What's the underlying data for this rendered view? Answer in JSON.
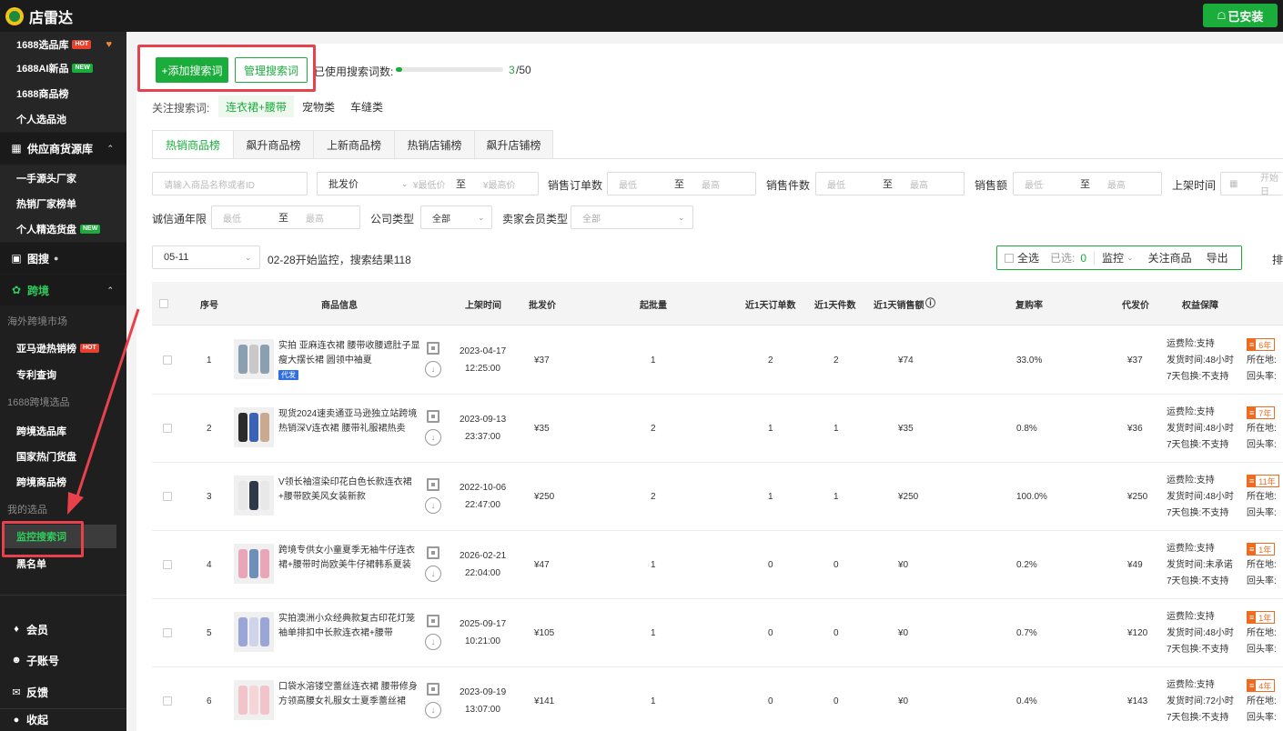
{
  "app": {
    "name": "店雷达",
    "installed_label": "已安装",
    "installed_icon": "home-icon"
  },
  "sidebar": {
    "items_top": [
      {
        "label": "1688选品库",
        "tag": "HOT"
      },
      {
        "label": "1688AI新品",
        "tag": "NEW"
      },
      {
        "label": "1688商品榜",
        "tag": ""
      },
      {
        "label": "个人选品池",
        "tag": ""
      }
    ],
    "group_supply": "供应商货源库",
    "supply_items": [
      {
        "label": "一手源头厂家",
        "tag": ""
      },
      {
        "label": "热销厂家榜单",
        "tag": ""
      },
      {
        "label": "个人精选货盘",
        "tag": "NEW"
      }
    ],
    "image_search": "图搜",
    "group_cross": "跨境",
    "cap_overseas": "海外跨境市场",
    "overseas_items": [
      {
        "label": "亚马逊热销榜",
        "tag": "HOT"
      },
      {
        "label": "专利查询",
        "tag": ""
      }
    ],
    "cap_1688": "1688跨境选品",
    "cross_items": [
      {
        "label": "跨境选品库"
      },
      {
        "label": "国家热门货盘"
      },
      {
        "label": "跨境商品榜"
      }
    ],
    "cap_mine": "我的选品",
    "selected": "监控搜索词",
    "blacklist": "黑名单",
    "bottom": [
      {
        "label": "会员",
        "icon": "diamond-icon"
      },
      {
        "label": "子账号",
        "icon": "users-icon"
      },
      {
        "label": "反馈",
        "icon": "chat-icon"
      },
      {
        "label": "收起",
        "icon": "collapse-icon"
      }
    ]
  },
  "toolbar": {
    "add_label": "+添加搜索词",
    "manage_label": "管理搜索词",
    "usage_label": "已使用搜索词数:",
    "usage_count": "3",
    "usage_total": "/50",
    "usage_fraction": 0.06
  },
  "keywords": {
    "label": "关注搜索词:",
    "items": [
      "连衣裙+腰带",
      "宠物类",
      "车缝类"
    ],
    "active": 0
  },
  "tabs": [
    "热销商品榜",
    "飙升商品榜",
    "上新商品榜",
    "热销店铺榜",
    "飙升店铺榜"
  ],
  "filters": {
    "search_placeholder": "请输入商品名称或者ID",
    "price_select": "批发价",
    "min_price": "¥最低价",
    "to": "至",
    "max_price": "¥最高价",
    "orders_label": "销售订单数",
    "low": "最低",
    "high": "最高",
    "pieces_label": "销售件数",
    "amount_label": "销售额",
    "listed_label": "上架时间",
    "start_date": "开始日",
    "years_label": "诚信通年限",
    "company_label": "公司类型",
    "company_value": "全部",
    "member_label": "卖家会员类型",
    "member_value": "全部"
  },
  "monitor": {
    "date": "05-11",
    "info": "02-28开始监控，搜索结果118",
    "select_all": "全选",
    "selected_label": "已选:",
    "selected_count": "0",
    "monitor_label": "监控",
    "follow_label": "关注商品",
    "export_label": "导出",
    "sort_label": "排"
  },
  "table": {
    "headers": {
      "seq": "序号",
      "info": "商品信息",
      "listed": "上架时间",
      "price": "批发价",
      "moq": "起批量",
      "orders": "近1天订单数",
      "pieces": "近1天件数",
      "sales": "近1天销售额",
      "repurchase": "复购率",
      "dropship": "代发价",
      "rights": "权益保障"
    },
    "rows": [
      {
        "seq": "1",
        "name": "实拍 亚麻连衣裙 腰带收腰遮肚子显瘦大摆长裙 圆领中袖夏",
        "daifa": "代发",
        "date": "2023-04-17",
        "time": "12:25:00",
        "price": "¥37",
        "moq": "1",
        "orders": "2",
        "pieces": "2",
        "sales": "¥74",
        "rep": "33.0%",
        "drop": "¥37",
        "freight": "运费险:支持",
        "ship": "发货时间:48小时",
        "ret": "7天包换:不支持",
        "years": "6年",
        "loc": "所在地:",
        "back": "回头率:",
        "colors": [
          "#8aa0b0",
          "#c9c9c9",
          "#8aa0b0"
        ]
      },
      {
        "seq": "2",
        "name": "现货2024速卖通亚马逊独立站跨境热销深V连衣裙 腰带礼服裙热卖",
        "daifa": "",
        "date": "2023-09-13",
        "time": "23:37:00",
        "price": "¥35",
        "moq": "2",
        "orders": "1",
        "pieces": "1",
        "sales": "¥35",
        "rep": "0.8%",
        "drop": "¥36",
        "freight": "运费险:支持",
        "ship": "发货时间:48小时",
        "ret": "7天包换:不支持",
        "years": "7年",
        "loc": "所在地:",
        "back": "回头率:",
        "colors": [
          "#2b2b2b",
          "#3a62b5",
          "#c9a98f"
        ]
      },
      {
        "seq": "3",
        "name": "V领长袖渲染印花白色长款连衣裙+腰带欧美风女装新款",
        "daifa": "",
        "date": "2022-10-06",
        "time": "22:47:00",
        "price": "¥250",
        "moq": "2",
        "orders": "1",
        "pieces": "1",
        "sales": "¥250",
        "rep": "100.0%",
        "drop": "¥250",
        "freight": "运费险:支持",
        "ship": "发货时间:48小时",
        "ret": "7天包换:不支持",
        "years": "11年",
        "loc": "所在地:",
        "back": "回头率:",
        "colors": [
          "#e8e8e8",
          "#2e3a4a",
          "#e8e8e8"
        ]
      },
      {
        "seq": "4",
        "name": "跨境专供女小童夏季无袖牛仔连衣裙+腰带时尚欧美牛仔裙韩系夏装",
        "daifa": "",
        "date": "2026-02-21",
        "time": "22:04:00",
        "price": "¥47",
        "moq": "1",
        "orders": "0",
        "pieces": "0",
        "sales": "¥0",
        "rep": "0.2%",
        "drop": "¥49",
        "freight": "运费险:支持",
        "ship": "发货时间:未承诺",
        "ret": "7天包换:不支持",
        "years": "1年",
        "loc": "所在地:",
        "back": "回头率:",
        "colors": [
          "#e9a6b8",
          "#6e8fb8",
          "#e9a6b8"
        ]
      },
      {
        "seq": "5",
        "name": "实拍澳洲小众经典款复古印花灯笼袖单排扣中长款连衣裙+腰带",
        "daifa": "",
        "date": "2025-09-17",
        "time": "10:21:00",
        "price": "¥105",
        "moq": "1",
        "orders": "0",
        "pieces": "0",
        "sales": "¥0",
        "rep": "0.7%",
        "drop": "¥120",
        "freight": "运费险:支持",
        "ship": "发货时间:48小时",
        "ret": "7天包换:不支持",
        "years": "1年",
        "loc": "所在地:",
        "back": "回头率:",
        "colors": [
          "#9aa7d6",
          "#d0d4ea",
          "#9aa7d6"
        ]
      },
      {
        "seq": "6",
        "name": "口袋水溶镂空蕾丝连衣裙 腰带修身方领高腰女礼服女士夏季蕾丝裙",
        "daifa": "",
        "date": "2023-09-19",
        "time": "13:07:00",
        "price": "¥141",
        "moq": "1",
        "orders": "0",
        "pieces": "0",
        "sales": "¥0",
        "rep": "0.4%",
        "drop": "¥143",
        "freight": "运费险:支持",
        "ship": "发货时间:72小时",
        "ret": "7天包换:不支持",
        "years": "4年",
        "loc": "所在地:",
        "back": "回头率:",
        "colors": [
          "#f0c4c8",
          "#f5d5d8",
          "#f0c4c8"
        ]
      }
    ]
  }
}
